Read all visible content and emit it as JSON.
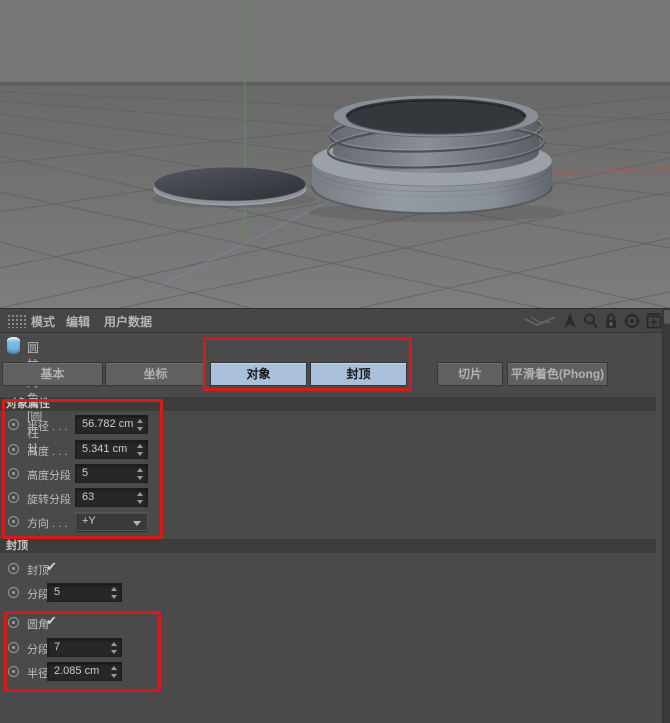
{
  "colors": {
    "highlight_red": "#d81a1a",
    "tab_active_blue": "#a9bfda",
    "panel_bg": "#4a4a4a",
    "field_bg": "#272727",
    "axis_x_red": "#a85a50",
    "axis_y_green": "#63905f",
    "axis_z_blue": "#8585c0",
    "object_icon_blue": "#7fc0e4"
  },
  "viewport": {
    "description": "3d-perspective-view-with-grid",
    "objects": [
      "cylinder-jar-with-threads",
      "flat-disc-cylinder"
    ]
  },
  "menu": {
    "items": [
      "模式",
      "编辑",
      "用户数据"
    ],
    "right_icons": [
      "axis-widget-icon",
      "nav-arrow-icon",
      "search-icon",
      "lock-icon",
      "target-icon",
      "add-panel-icon"
    ]
  },
  "header": {
    "icon": "cylinder-object-icon",
    "title": "圆柱对象 [圆柱 1]"
  },
  "tabs": [
    {
      "label": "基本",
      "active": false
    },
    {
      "label": "坐标",
      "active": false
    },
    {
      "label": "对象",
      "active": true
    },
    {
      "label": "封顶",
      "active": true
    },
    {
      "label": "切片",
      "active": false
    },
    {
      "label": "平滑着色(Phong)",
      "active": false
    }
  ],
  "object_properties": {
    "title": "对象属性",
    "rows": [
      {
        "label": "半径 . . .",
        "value": "56.782 cm",
        "control": "spinner"
      },
      {
        "label": "高度 . . .",
        "value": "5.341 cm",
        "control": "spinner"
      },
      {
        "label": "高度分段",
        "value": "5",
        "control": "spinner"
      },
      {
        "label": "旋转分段",
        "value": "63",
        "control": "spinner"
      },
      {
        "label": "方向 . . .",
        "value": "+Y",
        "control": "dropdown"
      }
    ]
  },
  "caps": {
    "title": "封顶",
    "rows": [
      {
        "label": "封顶",
        "check": "✔",
        "control": "checkbox"
      },
      {
        "label": "分段",
        "value": "5",
        "control": "spinner"
      },
      {
        "label": "圆角",
        "check": "✔",
        "control": "checkbox"
      },
      {
        "label": "分段",
        "value": "7",
        "control": "spinner"
      },
      {
        "label": "半径",
        "value": "2.085 cm",
        "control": "spinner"
      }
    ]
  }
}
